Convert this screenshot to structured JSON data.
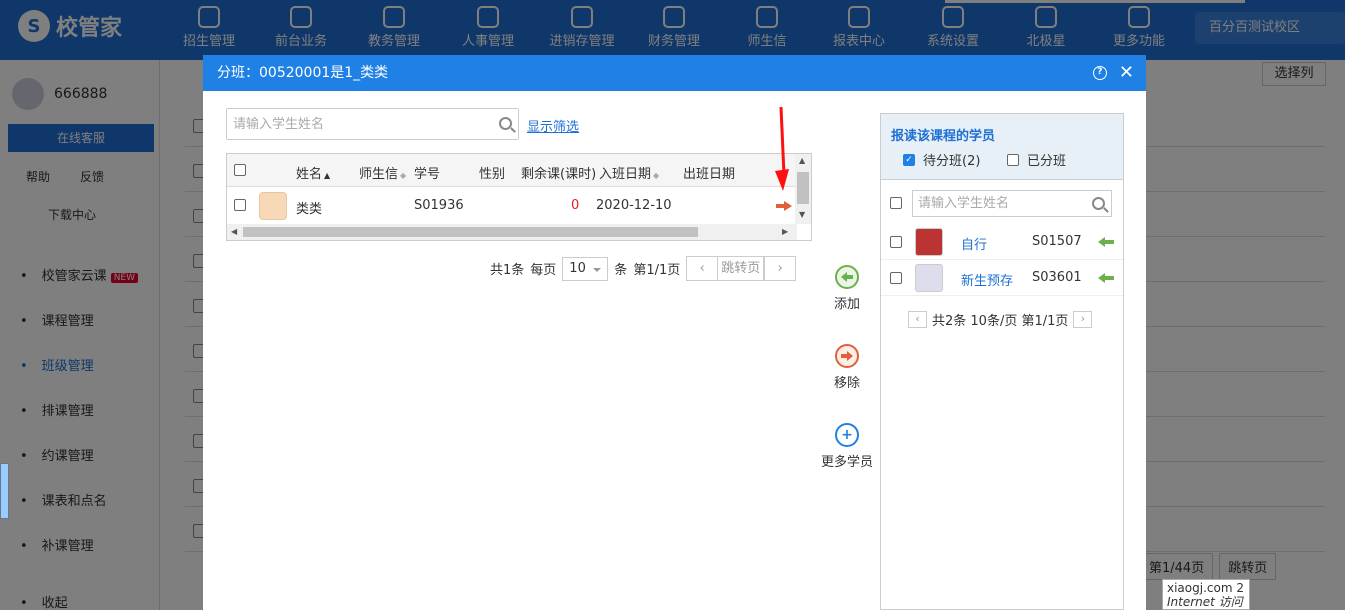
{
  "app": {
    "logo": "校管家",
    "campus": "百分百测试校区"
  },
  "nav": [
    "招生管理",
    "前台业务",
    "教务管理",
    "人事管理",
    "进销存管理",
    "财务管理",
    "师生信",
    "报表中心",
    "系统设置",
    "北极星",
    "更多功能"
  ],
  "sidebar": {
    "user": "666888",
    "service": "在线客服",
    "help": "帮助",
    "feedback": "反馈",
    "download": "下载中心",
    "menu": [
      "校管家云课",
      "课程管理",
      "班级管理",
      "排课管理",
      "约课管理",
      "课表和点名",
      "补课管理",
      "收起"
    ],
    "new_badge": "NEW"
  },
  "background": {
    "select_columns": "选择列",
    "pager": [
      "第1/44页",
      "跳转页"
    ]
  },
  "tooltip": {
    "line1": "xiaogj.com  2",
    "line2": "Internet 访问"
  },
  "modal": {
    "title": "分班：00520001是1_类类",
    "help_icon": "?",
    "close_icon": "✕",
    "search_placeholder": "请输入学生姓名",
    "filter_link": "显示筛选",
    "columns": [
      "姓名",
      "师生信",
      "学号",
      "性别",
      "剩余课(课时)",
      "入班日期",
      "出班日期"
    ],
    "rows": [
      {
        "name": "类类",
        "teacher": "",
        "id": "S01936",
        "gender": "",
        "remaining": "0",
        "join_date": "2020-12-10",
        "leave_date": ""
      }
    ],
    "pager": {
      "total": "共1条",
      "per_page_label": "每页",
      "per_page": "10",
      "unit": "条",
      "page": "第1/1页",
      "jump": "跳转页"
    },
    "actions": {
      "add": "添加",
      "remove": "移除",
      "more": "更多学员"
    },
    "right_panel": {
      "title": "报读该课程的学员",
      "pending": "待分班(2)",
      "assigned": "已分班",
      "search_placeholder": "请输入学生姓名",
      "students": [
        {
          "name": "自行",
          "id": "S01507"
        },
        {
          "name": "新生预存",
          "id": "S03601"
        }
      ],
      "pager": {
        "summary": "共2条 10条/页 第1/1页"
      }
    }
  },
  "colors": {
    "primary": "#1f80e6",
    "add": "#6ab04c",
    "remove": "#e0603a",
    "alert_arrow": "#ff1010"
  }
}
